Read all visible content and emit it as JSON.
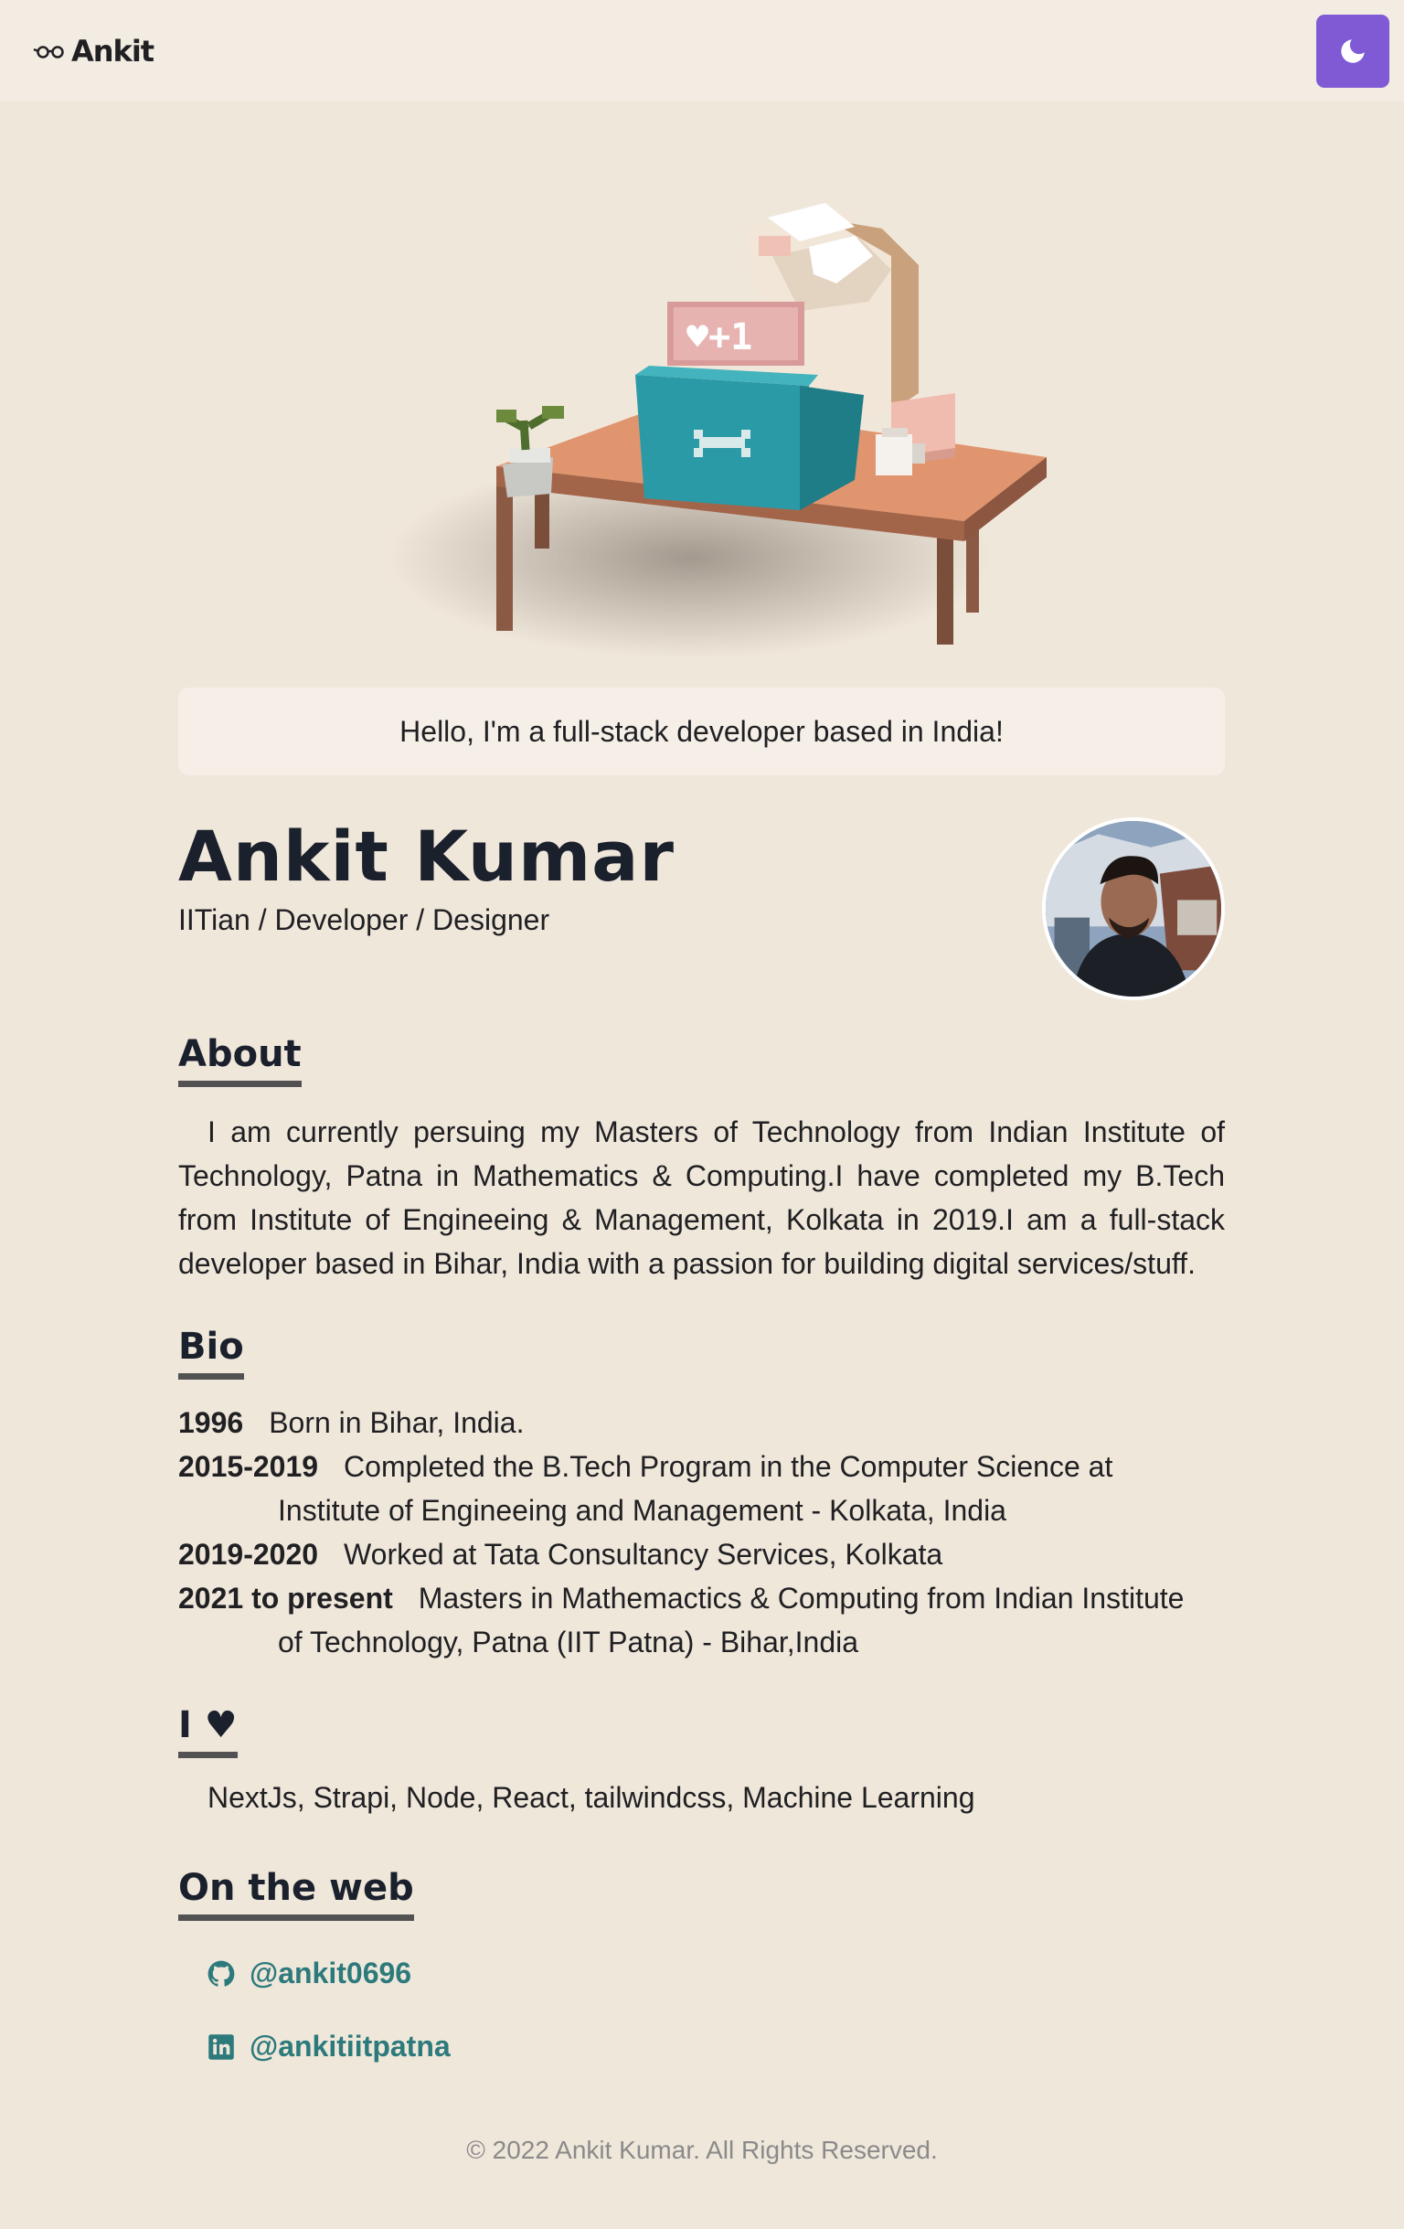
{
  "header": {
    "logo_text": "Ankit",
    "logo_icon": "glasses-icon",
    "theme_toggle_icon": "moon-icon",
    "accent": "#805ad5"
  },
  "hero": {
    "illustration": "voxel-dog-desk-illustration",
    "greeting": "Hello, I'm a full-stack developer based in India!"
  },
  "profile": {
    "name": "Ankit Kumar",
    "tagline": "IITian / Developer / Designer"
  },
  "about": {
    "title": "About",
    "text": "I am currently persuing my Masters of Technology from Indian Institute of Technology, Patna in Mathematics & Computing.I have completed my B.Tech from Institute of Engineeing & Management, Kolkata in 2019.I am a full-stack developer based in Bihar, India with a passion for building digital services/stuff."
  },
  "bio": {
    "title": "Bio",
    "items": [
      {
        "year": "1996",
        "text": "Born in Bihar, India.",
        "cont": ""
      },
      {
        "year": "2015-2019",
        "text": "Completed the B.Tech Program in the Computer Science at",
        "cont": "Institute of Engineeing and Management - Kolkata, India"
      },
      {
        "year": "2019-2020",
        "text": "Worked at Tata Consultancy Services, Kolkata",
        "cont": ""
      },
      {
        "year": "2021 to present",
        "text": "Masters in Mathemactics & Computing from Indian Institute",
        "cont": "of Technology, Patna (IIT Patna) - Bihar,India"
      }
    ]
  },
  "love": {
    "title": "I ♥",
    "text": "NextJs, Strapi, Node, React, tailwindcss, Machine Learning"
  },
  "web": {
    "title": "On the web",
    "links": [
      {
        "icon": "github-icon",
        "label": "@ankit0696"
      },
      {
        "icon": "linkedin-icon",
        "label": "@ankitiitpatna"
      }
    ],
    "link_color": "#2c7a7b"
  },
  "footer": {
    "text": "© 2022 Ankit Kumar. All Rights Reserved."
  }
}
